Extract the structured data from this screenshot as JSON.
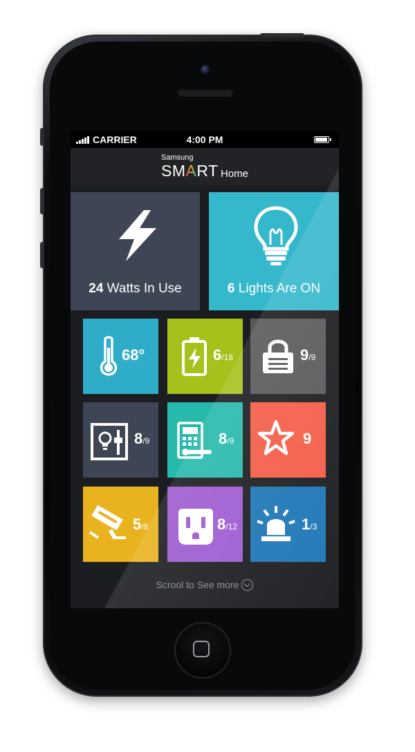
{
  "status": {
    "carrier": "CARRIER",
    "time": "4:00 PM",
    "battery_level": 1.0
  },
  "brand": {
    "maker": "Samsung",
    "smart_letters": [
      "SM",
      "A",
      "RT"
    ],
    "home": "Home"
  },
  "power": {
    "number": "24",
    "text": " Watts In Use",
    "color": "#3e4555"
  },
  "lights": {
    "number": "6",
    "text": " Lights Are ON",
    "color": "#36b8cc"
  },
  "tiles": [
    {
      "name": "temperature",
      "icon": "thermometer-icon",
      "main": "68°",
      "sub": "",
      "color": "#2fadc8"
    },
    {
      "name": "battery",
      "icon": "battery-charging-icon",
      "main": "6",
      "sub": "/18",
      "color": "#a6c11c"
    },
    {
      "name": "locks",
      "icon": "padlock-icon",
      "main": "9",
      "sub": "/9",
      "color": "#59595b"
    },
    {
      "name": "light-switches",
      "icon": "light-switch-icon",
      "main": "8",
      "sub": "/9",
      "color": "#3e4555"
    },
    {
      "name": "door-locks",
      "icon": "door-lock-icon",
      "main": "8",
      "sub": "/9",
      "color": "#27b9ab"
    },
    {
      "name": "favorites",
      "icon": "star-icon",
      "main": "9",
      "sub": "",
      "color": "#f45d48"
    },
    {
      "name": "cameras",
      "icon": "security-camera-icon",
      "main": "5",
      "sub": "/8",
      "color": "#e9b31f"
    },
    {
      "name": "outlets",
      "icon": "power-outlet-icon",
      "main": "8",
      "sub": "/12",
      "color": "#9e5bd0"
    },
    {
      "name": "alarms",
      "icon": "siren-icon",
      "main": "1",
      "sub": "/3",
      "color": "#1e76b6"
    }
  ],
  "footer": {
    "text": "Scrool to See more"
  }
}
